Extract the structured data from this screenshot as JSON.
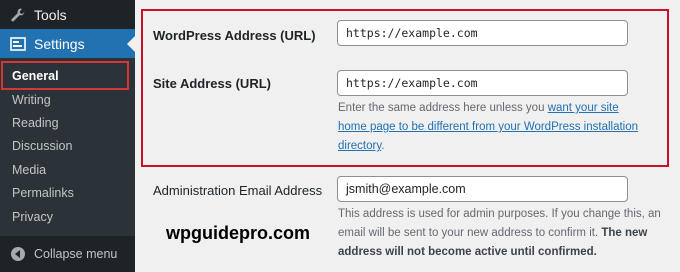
{
  "sidebar": {
    "tools": {
      "label": "Tools",
      "icon": "wrench-icon"
    },
    "settings": {
      "label": "Settings",
      "icon": "settings-icon"
    },
    "submenu": [
      "General",
      "Writing",
      "Reading",
      "Discussion",
      "Media",
      "Permalinks",
      "Privacy"
    ],
    "current": "General",
    "collapse_label": "Collapse menu",
    "collapse_icon": "collapse-arrow-icon"
  },
  "fields": {
    "wp_address": {
      "label": "WordPress Address (URL)",
      "value": "https://example.com"
    },
    "site_address": {
      "label": "Site Address (URL)",
      "value": "https://example.com",
      "desc_before": "Enter the same address here unless you ",
      "desc_link": "want your site home page to be different from your WordPress installation directory",
      "desc_after": "."
    },
    "admin_email": {
      "label": "Administration Email Address",
      "value": "jsmith@example.com",
      "desc": "This address is used for admin purposes. If you change this, an email will be sent to your new address to confirm it. ",
      "desc_bold": "The new address will not become active until confirmed."
    }
  },
  "watermark": "wpguidepro.com",
  "colors": {
    "sidebar_bg": "#1d2327",
    "submenu_bg": "#2c3338",
    "active_blue": "#2271b1",
    "highlight_red": "#c8102e",
    "page_bg": "#f0f0f1"
  }
}
